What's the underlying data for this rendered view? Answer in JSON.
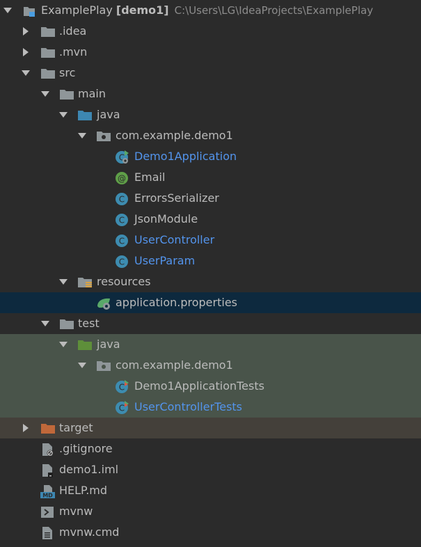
{
  "project": {
    "name": "ExamplePlay",
    "module": "[demo1]",
    "path": "C:\\Users\\LG\\IdeaProjects\\ExamplePlay"
  },
  "tree": [
    {
      "label": ".idea",
      "icon": "folder-icon"
    },
    {
      "label": ".mvn",
      "icon": "folder-icon"
    },
    {
      "label": "src",
      "icon": "folder-icon"
    },
    {
      "label": "main",
      "icon": "folder-icon"
    },
    {
      "label": "java",
      "icon": "source-folder-icon"
    },
    {
      "label": "com.example.demo1",
      "icon": "package-icon"
    },
    {
      "label": "Demo1Application",
      "icon": "spring-boot-class-icon"
    },
    {
      "label": "Email",
      "icon": "annotation-icon"
    },
    {
      "label": "ErrorsSerializer",
      "icon": "class-icon"
    },
    {
      "label": "JsonModule",
      "icon": "class-icon"
    },
    {
      "label": "UserController",
      "icon": "class-icon"
    },
    {
      "label": "UserParam",
      "icon": "class-icon"
    },
    {
      "label": "resources",
      "icon": "resources-folder-icon"
    },
    {
      "label": "application.properties",
      "icon": "spring-properties-icon"
    },
    {
      "label": "test",
      "icon": "folder-icon"
    },
    {
      "label": "java",
      "icon": "test-source-folder-icon"
    },
    {
      "label": "com.example.demo1",
      "icon": "package-icon"
    },
    {
      "label": "Demo1ApplicationTests",
      "icon": "test-class-icon"
    },
    {
      "label": "UserControllerTests",
      "icon": "test-class-icon"
    },
    {
      "label": "target",
      "icon": "excluded-folder-icon"
    },
    {
      "label": ".gitignore",
      "icon": "ignored-file-icon"
    },
    {
      "label": "demo1.iml",
      "icon": "module-file-icon"
    },
    {
      "label": "HELP.md",
      "icon": "markdown-file-icon"
    },
    {
      "label": "mvnw",
      "icon": "shell-script-icon"
    },
    {
      "label": "mvnw.cmd",
      "icon": "text-file-icon"
    }
  ],
  "colors": {
    "background": "#2b2b2b",
    "text": "#bbbbbb",
    "modified_text": "#5394ec",
    "selection": "#0d293e",
    "test_background": "#49544a",
    "excluded_background": "#44403a",
    "folder": "#8f9699",
    "source_folder": "#3d87b2",
    "test_folder": "#5e8f3a",
    "excluded_folder": "#c0683a",
    "class": "#3d8cb0",
    "annotation": "#5f9f48"
  }
}
